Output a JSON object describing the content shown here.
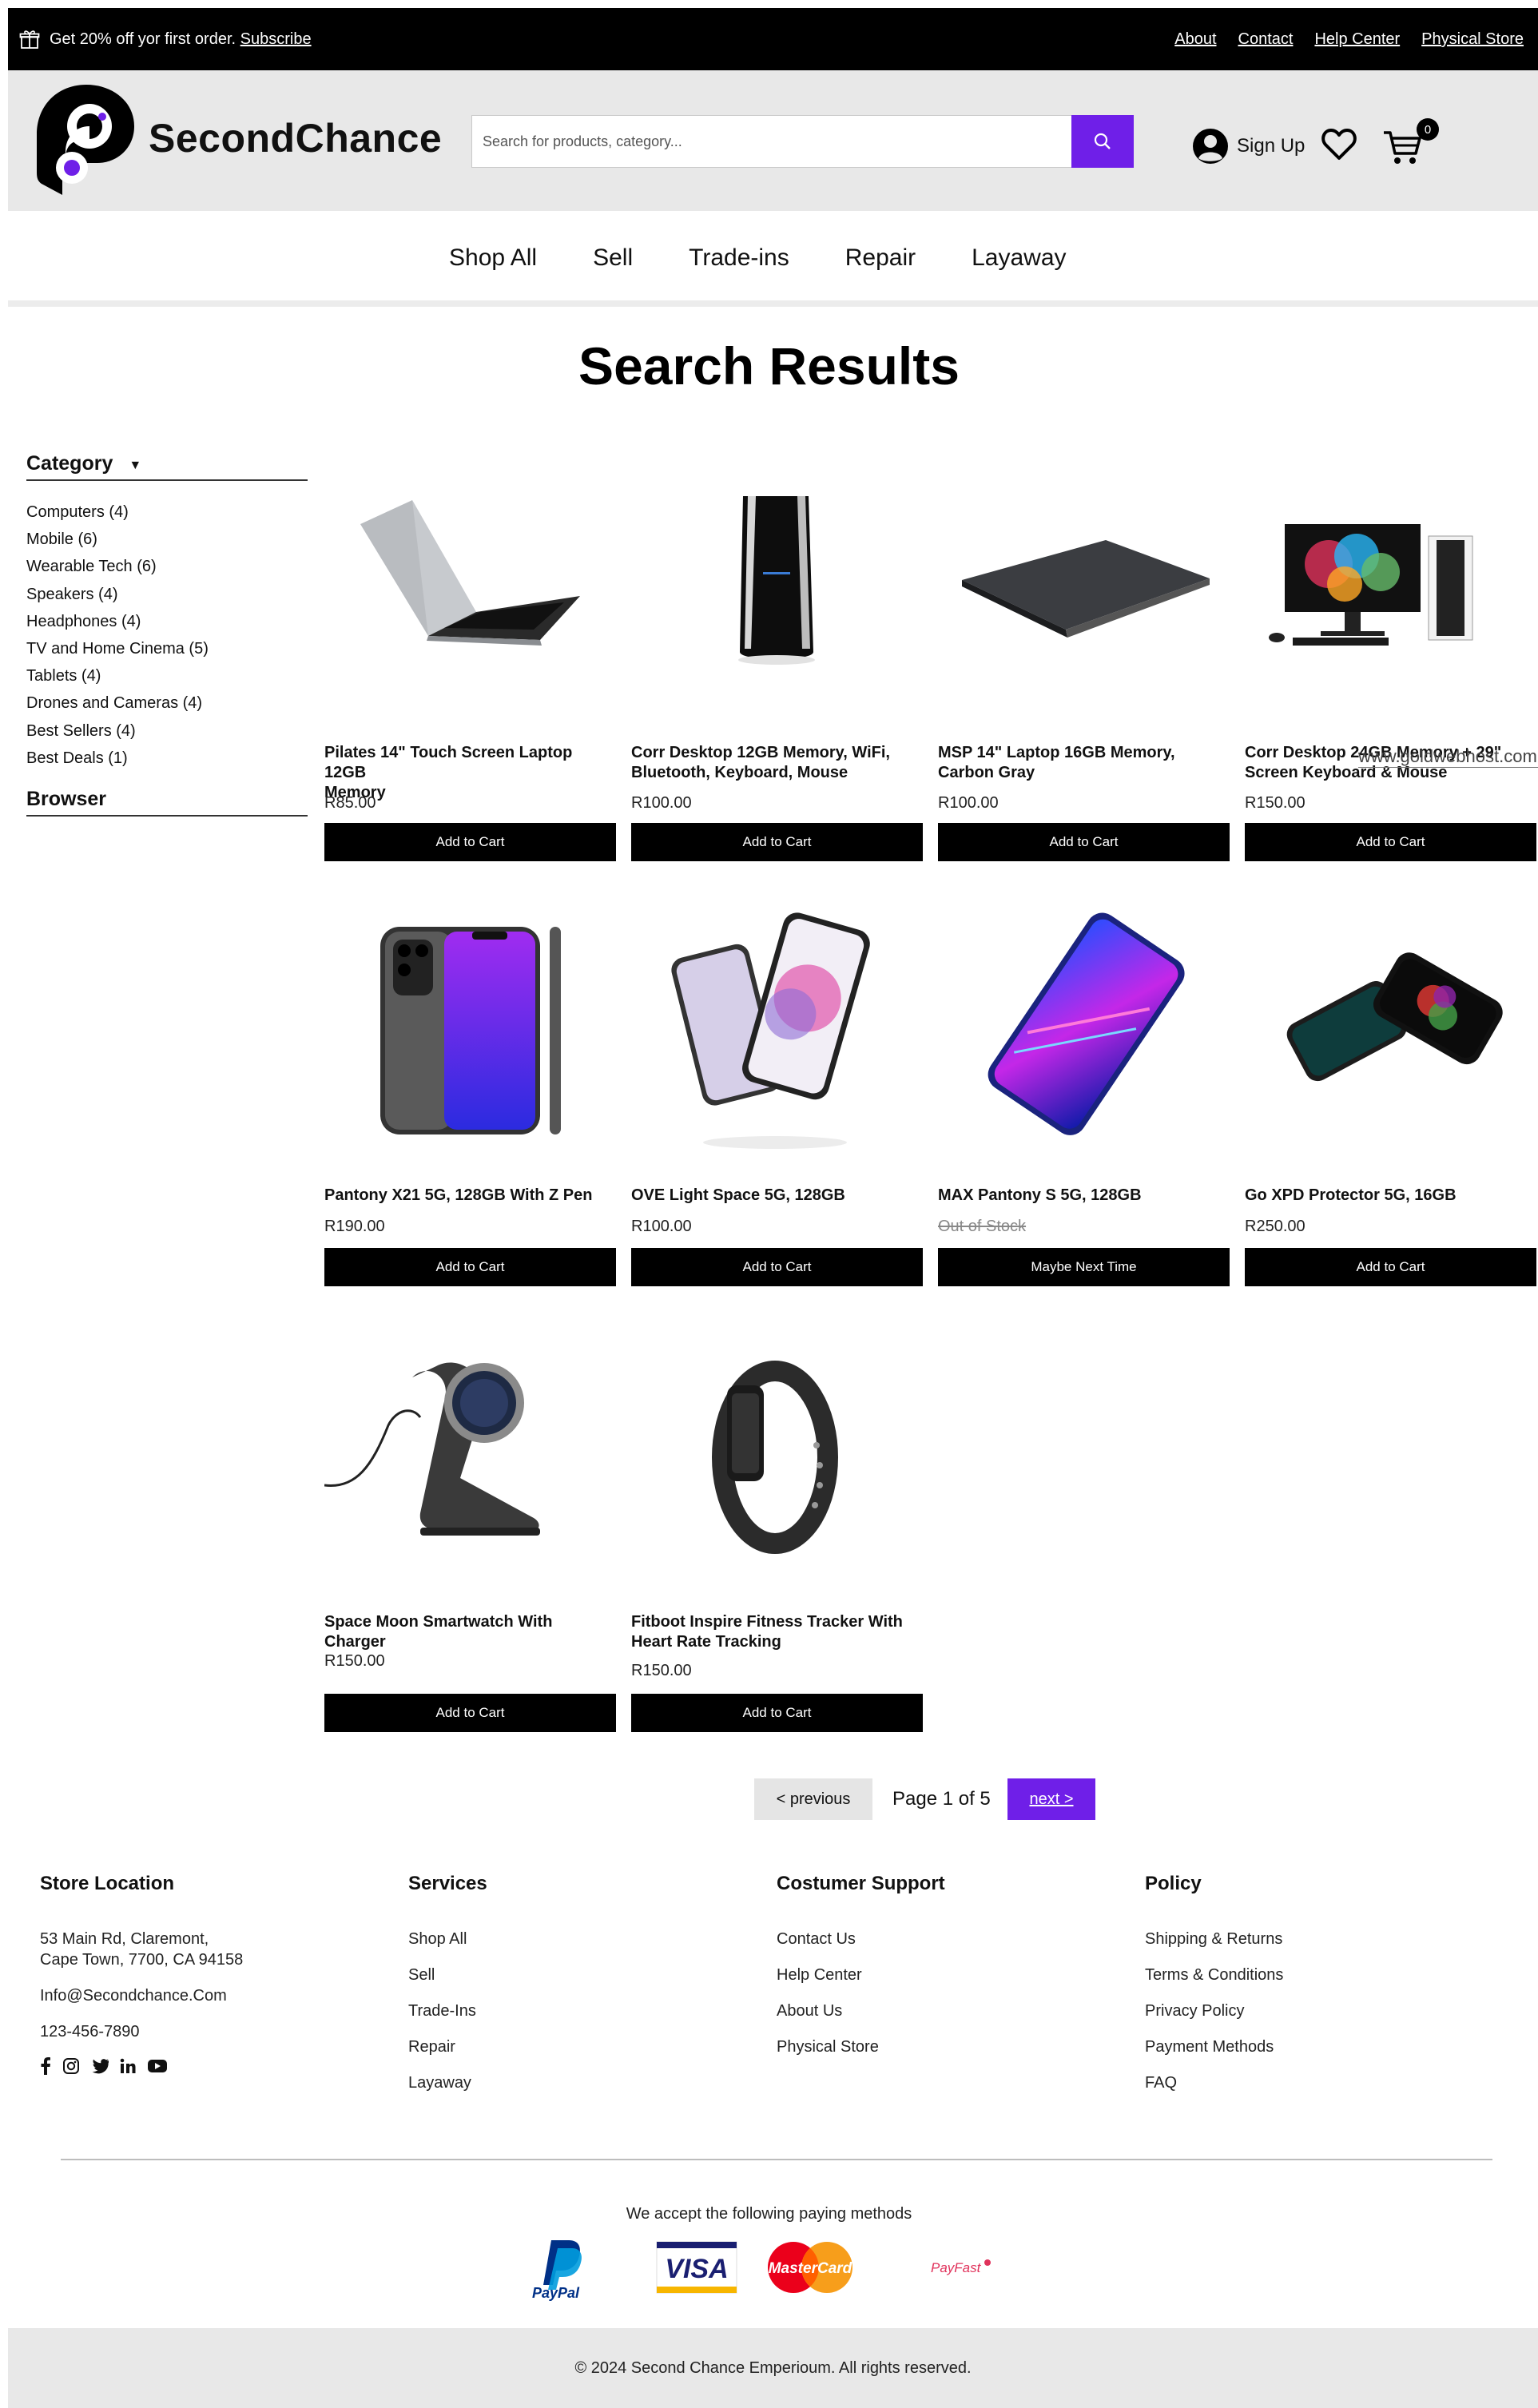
{
  "promo": {
    "text": "Get 20% off yor first order.",
    "link": "Subscribe",
    "links": [
      "About",
      "Contact",
      "Help Center",
      "Physical Store"
    ]
  },
  "header": {
    "brand": "SecondChance",
    "search_placeholder": "Search for products, category...",
    "signup": "Sign Up",
    "cart_count": "0",
    "accent_color": "#6f1fe8"
  },
  "nav": {
    "items": [
      "Shop All",
      "Sell",
      "Trade-ins",
      "Repair",
      "Layaway"
    ]
  },
  "main": {
    "title": "Search Results"
  },
  "sidebar": {
    "category_label": "Category",
    "browser_label": "Browser",
    "categories": [
      "Computers (4)",
      "Mobile (6)",
      "Wearable Tech (6)",
      "Speakers (4)",
      "Headphones (4)",
      "TV and Home Cinema (5)",
      "Tablets (4)",
      "Drones and Cameras (4)",
      "Best Sellers (4)",
      "Best Deals (1)"
    ]
  },
  "products": [
    {
      "name_1": "Pilates 14\" Touch Screen Laptop 12GB",
      "name_2": "Memory",
      "price": "R85.00",
      "button": "Add to Cart"
    },
    {
      "name_1": "Corr Desktop 12GB Memory, WiFi,",
      "name_2": "Bluetooth, Keyboard, Mouse",
      "price": "R100.00",
      "button": "Add to Cart"
    },
    {
      "name_1": "MSP 14\" Laptop 16GB Memory,",
      "name_2": "Carbon Gray",
      "price": "R100.00",
      "button": "Add to Cart"
    },
    {
      "name_1": "Corr Desktop 24GB Memory + 29\"",
      "name_2": "Screen Keyboard & Mouse",
      "price": "R150.00",
      "button": "Add to Cart"
    },
    {
      "name_1": "Pantony X21 5G, 128GB With Z Pen",
      "name_2": "",
      "price": "R190.00",
      "button": "Add to Cart"
    },
    {
      "name_1": "OVE Light Space 5G, 128GB",
      "name_2": "",
      "price": "R100.00",
      "button": "Add to Cart"
    },
    {
      "name_1": "MAX Pantony S 5G, 128GB",
      "name_2": "",
      "price": "Out of Stock",
      "button": "Maybe Next Time"
    },
    {
      "name_1": "Go XPD Protector 5G, 16GB",
      "name_2": "",
      "price": "R250.00",
      "button": "Add to Cart"
    },
    {
      "name_1": "Space Moon Smartwatch With Charger",
      "name_2": "",
      "price": "R150.00",
      "button": "Add to Cart"
    },
    {
      "name_1": "Fitboot Inspire Fitness Tracker With",
      "name_2": "Heart Rate Tracking",
      "price": "R150.00",
      "button": "Add to Cart"
    }
  ],
  "broken_image_text": "www.goldwebhost.com",
  "pagination": {
    "previous": "< previous",
    "info": "Page 1 of 5",
    "next": "next >"
  },
  "footer": {
    "store": {
      "title": "Store Location",
      "address_1": "53 Main Rd, Claremont,",
      "address_2": "Cape Town, 7700, CA 94158",
      "email": "Info@Secondchance.Com",
      "phone": "123-456-7890"
    },
    "services": {
      "title": "Services",
      "items": [
        "Shop All",
        "Sell",
        "Trade-Ins",
        "Repair",
        "Layaway"
      ]
    },
    "support": {
      "title": "Costumer Support",
      "items": [
        "Contact Us",
        "Help Center",
        "About Us",
        "Physical Store"
      ]
    },
    "policy": {
      "title": "Policy",
      "items": [
        "Shipping & Returns",
        "Terms & Conditions",
        "Privacy Policy",
        "Payment Methods",
        "FAQ"
      ]
    },
    "payment_text": "We accept the following paying methods",
    "payment_logos": [
      "PayPal",
      "VISA",
      "MasterCard",
      "PayFast"
    ],
    "copyright": "© 2024 Second Chance Emperioum. All rights reserved."
  }
}
